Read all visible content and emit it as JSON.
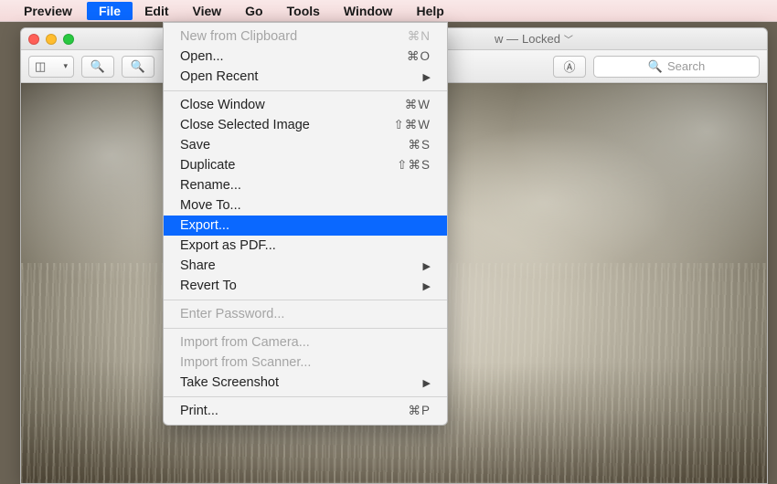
{
  "menubar": {
    "app_name": "Preview",
    "items": [
      "File",
      "Edit",
      "View",
      "Go",
      "Tools",
      "Window",
      "Help"
    ],
    "active_index": 0
  },
  "window": {
    "title_prefix": "w —",
    "title_status": "Locked",
    "search_placeholder": "Search"
  },
  "file_menu": [
    {
      "label": "New from Clipboard",
      "shortcut": "⌘N",
      "disabled": true
    },
    {
      "label": "Open...",
      "shortcut": "⌘O"
    },
    {
      "label": "Open Recent",
      "submenu": true
    },
    {
      "sep": true
    },
    {
      "label": "Close Window",
      "shortcut": "⌘W"
    },
    {
      "label": "Close Selected Image",
      "shortcut": "⇧⌘W"
    },
    {
      "label": "Save",
      "shortcut": "⌘S"
    },
    {
      "label": "Duplicate",
      "shortcut": "⇧⌘S"
    },
    {
      "label": "Rename..."
    },
    {
      "label": "Move To..."
    },
    {
      "label": "Export...",
      "selected": true
    },
    {
      "label": "Export as PDF..."
    },
    {
      "label": "Share",
      "submenu": true
    },
    {
      "label": "Revert To",
      "submenu": true
    },
    {
      "sep": true
    },
    {
      "label": "Enter Password...",
      "disabled": true
    },
    {
      "sep": true
    },
    {
      "label": "Import from Camera...",
      "disabled": true
    },
    {
      "label": "Import from Scanner...",
      "disabled": true
    },
    {
      "label": "Take Screenshot",
      "submenu": true
    },
    {
      "sep": true
    },
    {
      "label": "Print...",
      "shortcut": "⌘P"
    }
  ]
}
